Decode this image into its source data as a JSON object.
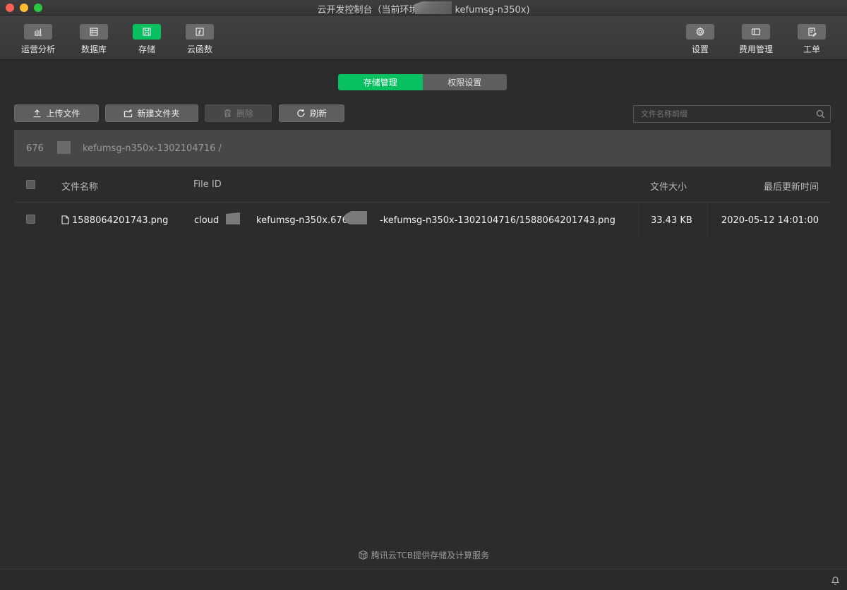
{
  "window": {
    "title_prefix": "云开发控制台（当前环境",
    "title_suffix": "kefumsg-n350x)"
  },
  "toolbar": {
    "left": [
      {
        "label": "运营分析",
        "icon": "bar-chart-icon"
      },
      {
        "label": "数据库",
        "icon": "database-icon"
      },
      {
        "label": "存储",
        "icon": "storage-icon",
        "active": true
      },
      {
        "label": "云函数",
        "icon": "function-icon"
      }
    ],
    "right": [
      {
        "label": "设置",
        "icon": "gear-icon"
      },
      {
        "label": "费用管理",
        "icon": "billing-icon"
      },
      {
        "label": "工单",
        "icon": "ticket-icon"
      }
    ]
  },
  "tabs": {
    "storage_manage": "存储管理",
    "permission_settings": "权限设置"
  },
  "actions": {
    "upload": "上传文件",
    "new_folder": "新建文件夹",
    "delete": "删除",
    "refresh": "刷新"
  },
  "search": {
    "placeholder": "文件名称前缀"
  },
  "breadcrumb": {
    "prefix": "676",
    "path": "kefumsg-n350x-1302104716 /"
  },
  "table": {
    "headers": {
      "name": "文件名称",
      "file_id": "File ID",
      "size": "文件大小",
      "updated": "最后更新时间"
    },
    "rows": [
      {
        "name": "1588064201743.png",
        "file_id_part1": "cloud",
        "file_id_part2": "kefumsg-n350x.676",
        "file_id_part3": "-kefumsg-n350x-1302104716/1588064201743.png",
        "size": "33.43 KB",
        "updated": "2020-05-12 14:01:00"
      }
    ]
  },
  "footer": {
    "note": "腾讯云TCB提供存储及计算服务"
  },
  "colors": {
    "accent": "#07c160",
    "background": "#2c2c2c"
  }
}
